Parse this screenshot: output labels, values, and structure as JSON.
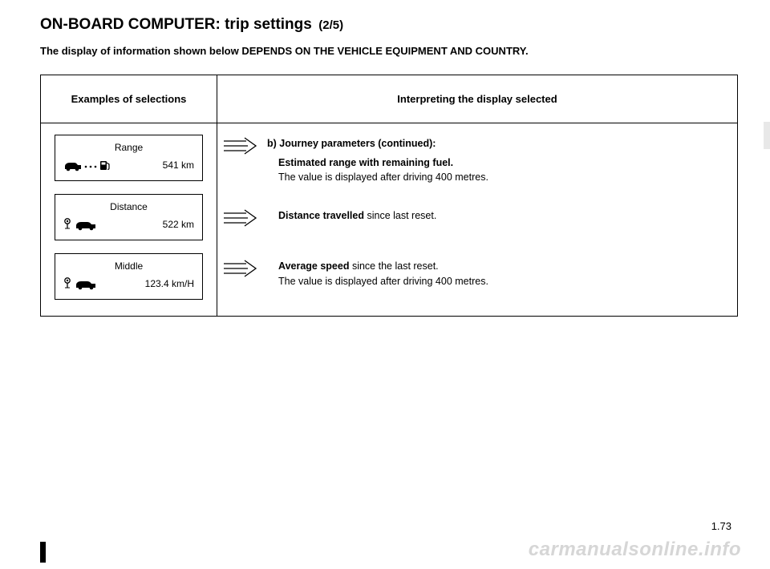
{
  "title": {
    "main": "ON-BOARD COMPUTER: trip settings",
    "sub": "(2/5)"
  },
  "note": "The display of information shown below DEPENDS ON THE VEHICLE EQUIPMENT AND COUNTRY.",
  "headers": {
    "left": "Examples of selections",
    "right": "Interpreting the display selected"
  },
  "displays": [
    {
      "label": "Range",
      "value": "541 km",
      "icon": "car-fuel"
    },
    {
      "label": "Distance",
      "value": "522 km",
      "icon": "pin-car"
    },
    {
      "label": "Middle",
      "value": "123.4 km/H",
      "icon": "pin-car"
    }
  ],
  "items": [
    {
      "header": "b) Journey parameters (continued):",
      "bold": "Estimated range with remaining fuel.",
      "plain": "The value is displayed after driving 400 metres.",
      "indent": true
    },
    {
      "bold": "Distance travelled",
      "plain_inline": " since last reset.",
      "indent": true
    },
    {
      "bold": "Average speed",
      "plain_inline": " since the last reset.",
      "plain2": "The value is displayed after driving 400 metres.",
      "indent": true
    }
  ],
  "pagenum": "1.73",
  "watermark": "carmanualsonline.info"
}
